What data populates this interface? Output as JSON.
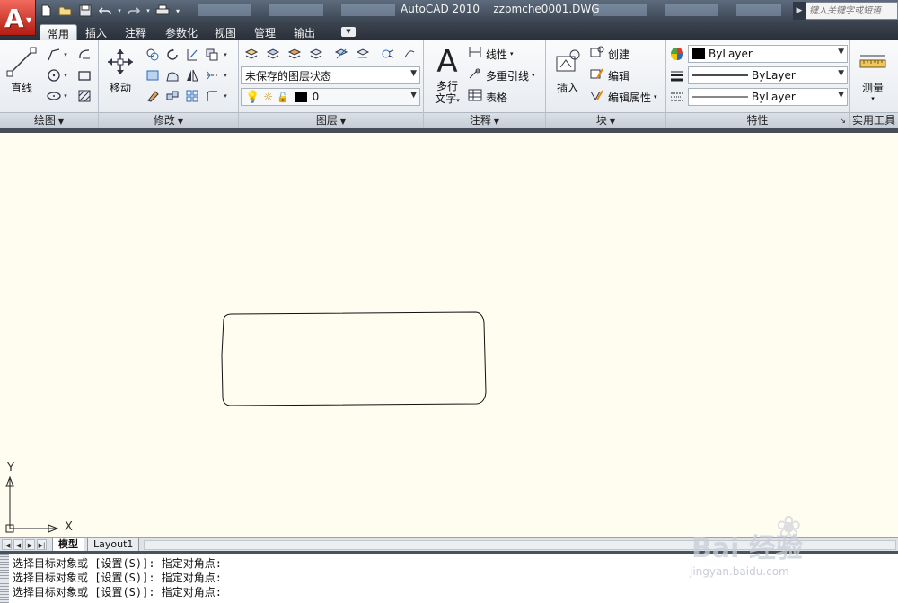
{
  "window": {
    "app_name": "AutoCAD 2010",
    "file_name": "zzpmche0001.DWG",
    "search_placeholder": "键入关键字或短语"
  },
  "app_button": {
    "letter": "A"
  },
  "quick_access": [
    {
      "name": "new-icon",
      "glyph": "🗋"
    },
    {
      "name": "open-icon",
      "glyph": "📂"
    },
    {
      "name": "save-icon",
      "glyph": "💾"
    },
    {
      "name": "undo-icon",
      "glyph": "↶"
    },
    {
      "name": "redo-icon",
      "glyph": "↷"
    },
    {
      "name": "plot-icon",
      "glyph": "🖶"
    }
  ],
  "tabs": [
    "常用",
    "插入",
    "注释",
    "参数化",
    "视图",
    "管理",
    "输出"
  ],
  "active_tab": "常用",
  "ribbon": {
    "draw": {
      "title": "绘图",
      "line_label": "直线"
    },
    "modify": {
      "title": "修改",
      "move_label": "移动"
    },
    "layers": {
      "title": "图层",
      "layer_state": "未保存的图层状态",
      "current_layer": "0"
    },
    "annotation": {
      "title": "注释",
      "mtext_label_1": "多行",
      "mtext_label_2": "文字",
      "linear": "线性",
      "mleader": "多重引线",
      "table": "表格"
    },
    "block": {
      "title": "块",
      "insert": "插入",
      "create": "创建",
      "edit": "编辑",
      "edit_attr": "编辑属性"
    },
    "properties": {
      "title": "特性",
      "color": "ByLayer",
      "linetype": "ByLayer",
      "lineweight": "ByLayer"
    },
    "utilities": {
      "title": "实用工具",
      "measure": "测量"
    }
  },
  "canvas": {
    "background": "#fffcf0",
    "axis_x": "X",
    "axis_y": "Y"
  },
  "layout_tabs": [
    "模型",
    "Layout1"
  ],
  "active_layout": "模型",
  "command_lines": [
    "选择目标对象或 [设置(S)]: 指定对角点:",
    "选择目标对象或 [设置(S)]: 指定对角点:",
    "选择目标对象或 [设置(S)]: 指定对角点:"
  ],
  "watermark": {
    "brand": "Bai 经验",
    "url": "jingyan.baidu.com"
  },
  "colors": {
    "titlebar": "#3b4654",
    "app_button": "#c8261a",
    "ribbon_bg": "#eef1f5",
    "canvas_bg": "#fffcf0"
  }
}
